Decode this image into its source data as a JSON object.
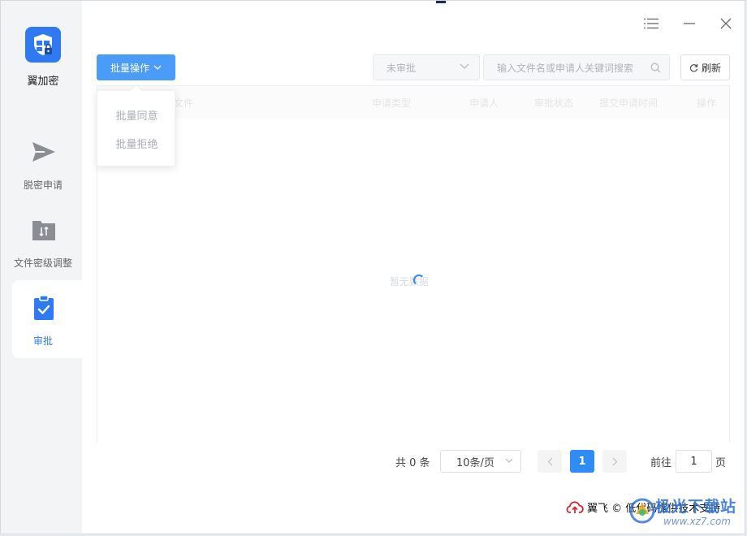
{
  "app": {
    "name": "翼加密"
  },
  "sidebar": {
    "items": [
      {
        "label": "脱密申请",
        "icon": "send-icon"
      },
      {
        "label": "文件密级调整",
        "icon": "folder-adjust-icon"
      },
      {
        "label": "审批",
        "icon": "clipboard-check-icon",
        "active": true
      }
    ]
  },
  "toolbar": {
    "batch_label": "批量操作",
    "status_select_value": "未审批",
    "search_placeholder": "输入文件名或申请人关键词搜索",
    "refresh_label": "刷新"
  },
  "dropdown": {
    "items": [
      "批量同意",
      "批量拒绝"
    ]
  },
  "table": {
    "columns": [
      "文件",
      "申请类型",
      "申请人",
      "审批状态",
      "提交申请时间",
      "操作"
    ],
    "empty_text": "暂无数据"
  },
  "pagination": {
    "total_text": "共 0 条",
    "page_size": "10条/页",
    "current_page": "1",
    "goto_label": "前往",
    "goto_value": "1",
    "page_suffix": "页"
  },
  "footer": {
    "text": "翼飞 © 低代码提供技术支持"
  },
  "watermark": {
    "title": "极光下载站",
    "url": "www.xz7.com"
  },
  "colors": {
    "primary": "#2f7af2",
    "batch_button": "#4a9cf8",
    "sidebar_bg": "#f3f4f6",
    "footer_cloud": "#d9232e"
  }
}
